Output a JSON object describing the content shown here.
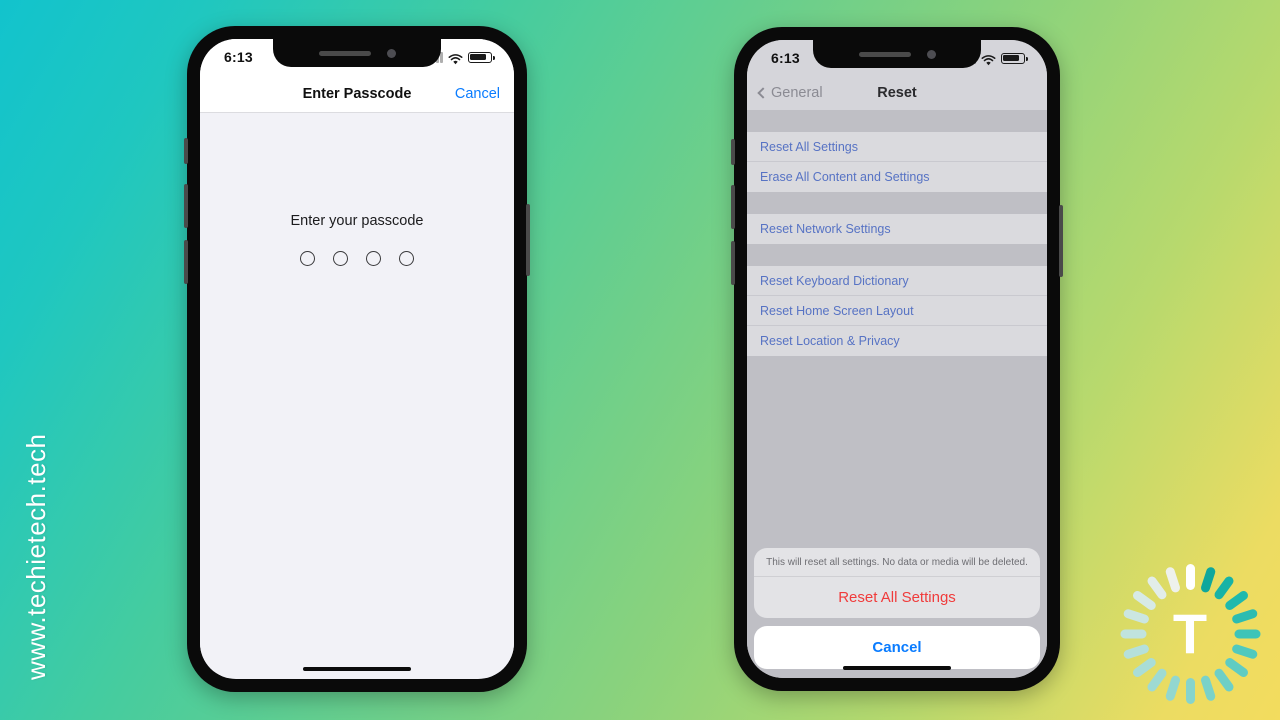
{
  "background": {
    "gradient_start": "#12c3cd",
    "gradient_mid": "#8ed37b",
    "gradient_end": "#f3dc5e"
  },
  "watermark": {
    "text": "www.techietech.tech",
    "color": "#ffffff"
  },
  "logo": {
    "letter": "T",
    "ray_colors": [
      "#ffffff",
      "#0fa79c",
      "#17b3a6",
      "#1fb9ad",
      "#2cbcb1",
      "#3ec4b8",
      "#50c9bd",
      "#5fccc2",
      "#6ecfc6",
      "#7ad2c9",
      "#86d4cc",
      "#92d7cf",
      "#9edad3",
      "#a9ddd7",
      "#b5e0da",
      "#c0e3de",
      "#cbe6e1",
      "#d7eae5",
      "#e2ede9",
      "#eef1ec"
    ]
  },
  "left_phone": {
    "status_bar": {
      "time": "6:13",
      "signal_icon": "cellular-bars-icon",
      "wifi_icon": "wifi-icon",
      "battery_icon": "battery-icon",
      "battery_level_pct": 80
    },
    "nav": {
      "title": "Enter Passcode",
      "cancel_label": "Cancel",
      "cancel_color": "#0a7cff"
    },
    "passcode": {
      "prompt": "Enter your passcode",
      "digit_count": 4,
      "filled_count": 0
    }
  },
  "right_phone": {
    "status_bar": {
      "time": "6:13",
      "signal_icon": "cellular-bars-icon",
      "wifi_icon": "wifi-icon",
      "battery_icon": "battery-icon",
      "battery_level_pct": 80
    },
    "nav": {
      "back_label": "General",
      "back_icon": "chevron-left-icon",
      "title": "Reset"
    },
    "groups": [
      {
        "rows": [
          "Reset All Settings",
          "Erase All Content and Settings"
        ]
      },
      {
        "rows": [
          "Reset Network Settings"
        ]
      },
      {
        "rows": [
          "Reset Keyboard Dictionary",
          "Reset Home Screen Layout",
          "Reset Location & Privacy"
        ]
      }
    ],
    "action_sheet": {
      "message": "This will reset all settings. No data or media will be deleted.",
      "destructive_label": "Reset All Settings",
      "destructive_color": "#f03b3b",
      "cancel_label": "Cancel",
      "cancel_color": "#0a7cff"
    }
  }
}
